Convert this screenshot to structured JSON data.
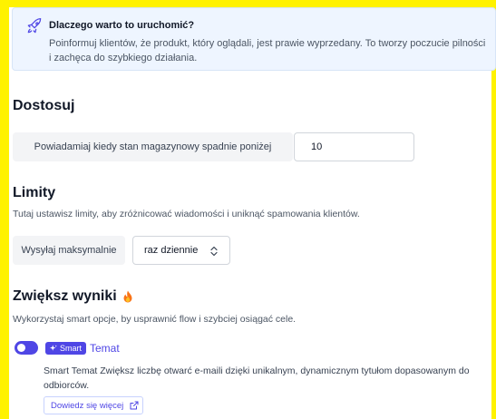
{
  "info": {
    "title": "Dlaczego warto to uruchomić?",
    "text": "Poinformuj klientów, że produkt, który oglądali, jest prawie wyprzedany. To tworzy poczucie pilności i zachęca do szybkiego działania."
  },
  "customize": {
    "heading": "Dostosuj",
    "label": "Powiadamiaj kiedy stan magazynowy spadnie poniżej",
    "value": "10"
  },
  "limits": {
    "heading": "Limity",
    "description": "Tutaj ustawisz limity, aby zróżnicować wiadomości i uniknąć spamowania klientów.",
    "label": "Wysyłaj maksymalnie",
    "select_value": "raz dziennie"
  },
  "boost": {
    "heading": "Zwiększ wyniki",
    "heading_icon": "fire-icon",
    "description": "Wykorzystaj smart opcje, by usprawnić flow i szybciej osiągać cele."
  },
  "smart_subject": {
    "enabled": true,
    "badge": "Smart",
    "title": "Temat",
    "description": "Smart Temat Zwiększ liczbę otwarć e-maili dzięki unikalnym, dynamicznym tytułom dopasowanym do odbiorców.",
    "learn_more": "Dowiedz się więcej"
  },
  "colors": {
    "accent": "#4f46e5",
    "info_bg": "#eef5ff",
    "frame": "#fff200"
  }
}
